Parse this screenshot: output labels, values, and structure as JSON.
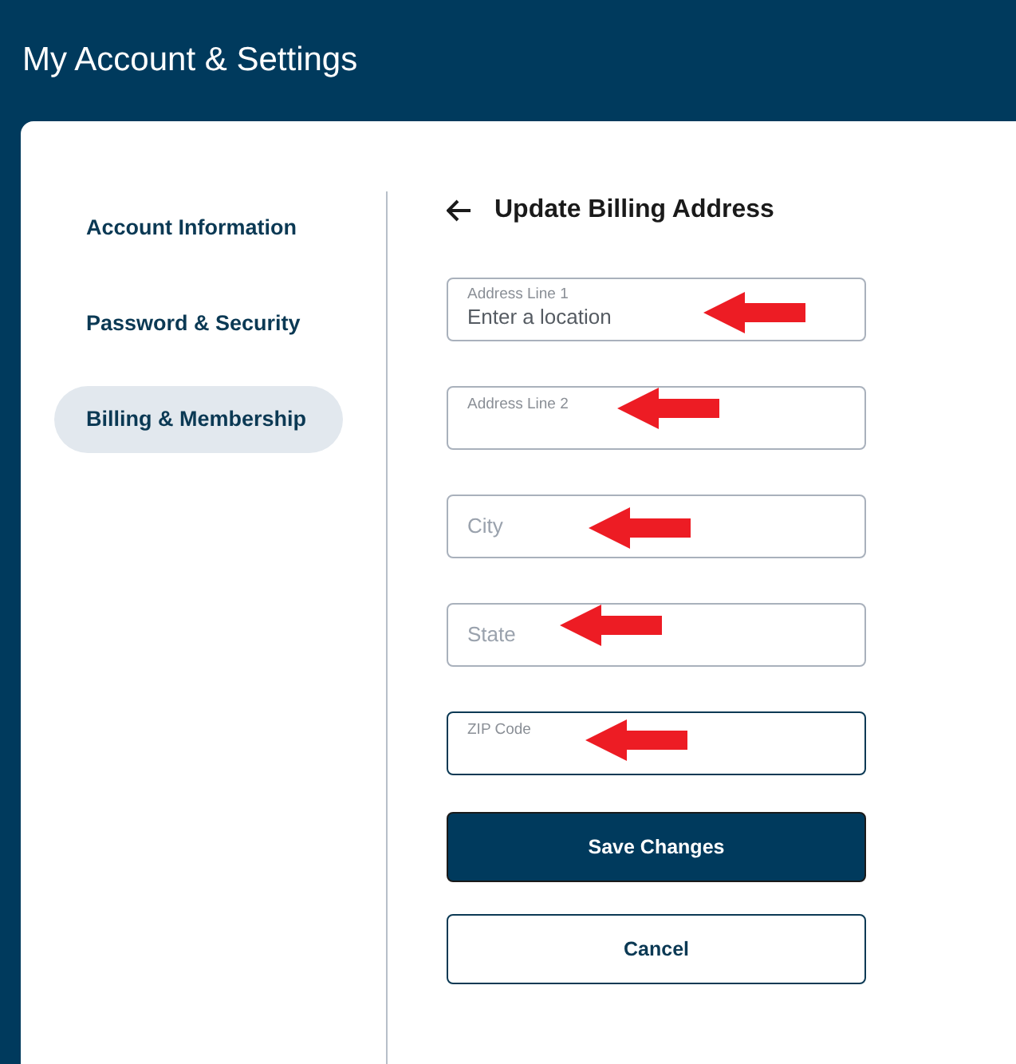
{
  "header": {
    "title": "My Account & Settings"
  },
  "sidebar": {
    "items": [
      {
        "label": "Account Information",
        "selected": false
      },
      {
        "label": "Password & Security",
        "selected": false
      },
      {
        "label": "Billing & Membership",
        "selected": true
      }
    ]
  },
  "form": {
    "title": "Update Billing Address",
    "fields": [
      {
        "label": "Address Line 1",
        "placeholder": "Enter a location",
        "focused": false,
        "annotated": true
      },
      {
        "label": "Address Line 2",
        "focused": false,
        "annotated": true
      },
      {
        "placeholder": "City",
        "focused": false,
        "annotated": true
      },
      {
        "placeholder": "State",
        "focused": false,
        "annotated": true
      },
      {
        "label": "ZIP Code",
        "focused": true,
        "annotated": true
      }
    ],
    "buttons": [
      {
        "label": "Save Changes",
        "kind": "primary"
      },
      {
        "label": "Cancel",
        "kind": "secondary"
      }
    ]
  }
}
